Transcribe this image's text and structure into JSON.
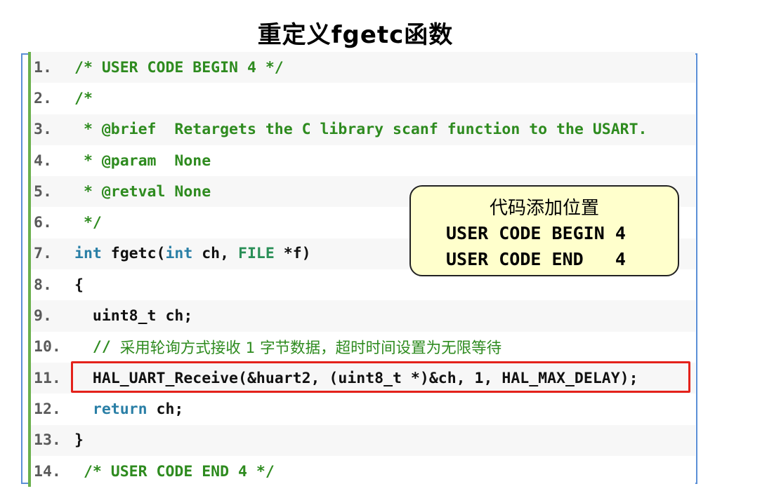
{
  "title": "重定义fgetc函数",
  "code_lines": [
    {
      "num": "1.",
      "segments": [
        {
          "cls": "cm",
          "text": "/* USER CODE BEGIN 4 */"
        }
      ]
    },
    {
      "num": "2.",
      "segments": [
        {
          "cls": "cm",
          "text": "/*"
        }
      ]
    },
    {
      "num": "3.",
      "segments": [
        {
          "cls": "cm",
          "text": " * @brief  Retargets the C library scanf function to the USART."
        }
      ]
    },
    {
      "num": "4.",
      "segments": [
        {
          "cls": "cm",
          "text": " * @param  None"
        }
      ]
    },
    {
      "num": "5.",
      "segments": [
        {
          "cls": "cm",
          "text": " * @retval None"
        }
      ]
    },
    {
      "num": "6.",
      "segments": [
        {
          "cls": "cm",
          "text": " */"
        }
      ]
    },
    {
      "num": "7.",
      "segments": [
        {
          "cls": "kw",
          "text": "int"
        },
        {
          "cls": "tx",
          "text": " fgetc("
        },
        {
          "cls": "kw",
          "text": "int"
        },
        {
          "cls": "tx",
          "text": " ch, "
        },
        {
          "cls": "ty",
          "text": "FILE"
        },
        {
          "cls": "tx",
          "text": " *f)"
        }
      ]
    },
    {
      "num": "8.",
      "segments": [
        {
          "cls": "tx",
          "text": "{"
        }
      ]
    },
    {
      "num": "9.",
      "segments": [
        {
          "cls": "tx",
          "text": "  uint8_t ch;"
        }
      ]
    },
    {
      "num": "10.",
      "segments": [
        {
          "cls": "cm",
          "text": "  // "
        },
        {
          "cls": "zh",
          "text": "采用轮询方式接收 1 字节数据，超时时间设置为无限等待"
        }
      ]
    },
    {
      "num": "11.",
      "segments": [
        {
          "cls": "tx",
          "text": "  HAL_UART_Receive(&huart2, (uint8_t *)&ch, 1, HAL_MAX_DELAY);"
        }
      ]
    },
    {
      "num": "12.",
      "segments": [
        {
          "cls": "kw",
          "text": "  return"
        },
        {
          "cls": "tx",
          "text": " ch;"
        }
      ]
    },
    {
      "num": "13.",
      "segments": [
        {
          "cls": "tx",
          "text": "}"
        }
      ]
    },
    {
      "num": "14.",
      "segments": [
        {
          "cls": "cm",
          "text": " /* USER CODE END 4 */"
        }
      ]
    }
  ],
  "callout": {
    "line1": "代码添加位置",
    "line2": "USER CODE BEGIN 4",
    "line3": "USER CODE END   4"
  }
}
